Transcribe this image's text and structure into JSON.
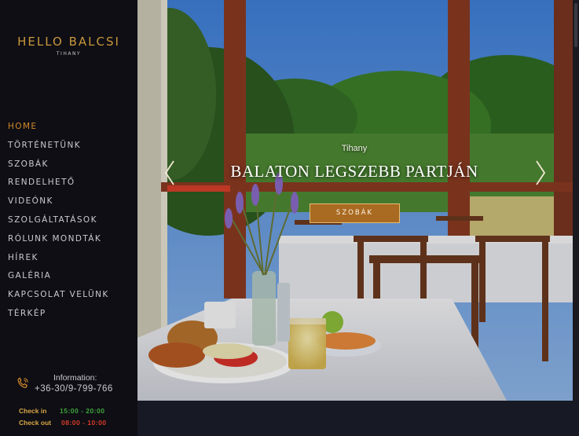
{
  "brand": {
    "name": "HELLO BALCSI",
    "location": "TIHANY"
  },
  "nav": [
    {
      "label": "HOME",
      "active": true
    },
    {
      "label": "TÖRTÉNETÜNK",
      "active": false
    },
    {
      "label": "SZOBÁK",
      "active": false
    },
    {
      "label": "RENDELHETŐ",
      "active": false
    },
    {
      "label": "VIDEÓNK",
      "active": false
    },
    {
      "label": "SZOLGÁLTATÁSOK",
      "active": false
    },
    {
      "label": "RÓLUNK MONDTÁK",
      "active": false
    },
    {
      "label": "HÍREK",
      "active": false
    },
    {
      "label": "GALÉRIA",
      "active": false
    },
    {
      "label": "KAPCSOLAT VELÜNK",
      "active": false
    },
    {
      "label": "TÉRKÉP",
      "active": false
    }
  ],
  "info": {
    "label": "Information:",
    "phone": "+36-30/9-799-766",
    "check_in_label": "Check in",
    "check_in_time": "15:00 - 20:00",
    "check_out_label": "Check out",
    "check_out_time": "08:00 - 10:00"
  },
  "slider": {
    "subtitle": "Tihany",
    "title": "BALATON LEGSZEBB PARTJÁN",
    "button": "SZOBÁK"
  },
  "icons": {
    "phone": "phone-icon",
    "prev": "chevron-left-icon",
    "next": "chevron-right-icon"
  },
  "colors": {
    "accent": "#c9973c",
    "active_nav": "#d48a2a",
    "button_bg": "#a96a21",
    "check_in": "#3fa63a",
    "check_out": "#d83a2a",
    "sidebar_bg": "#0e0e14"
  }
}
